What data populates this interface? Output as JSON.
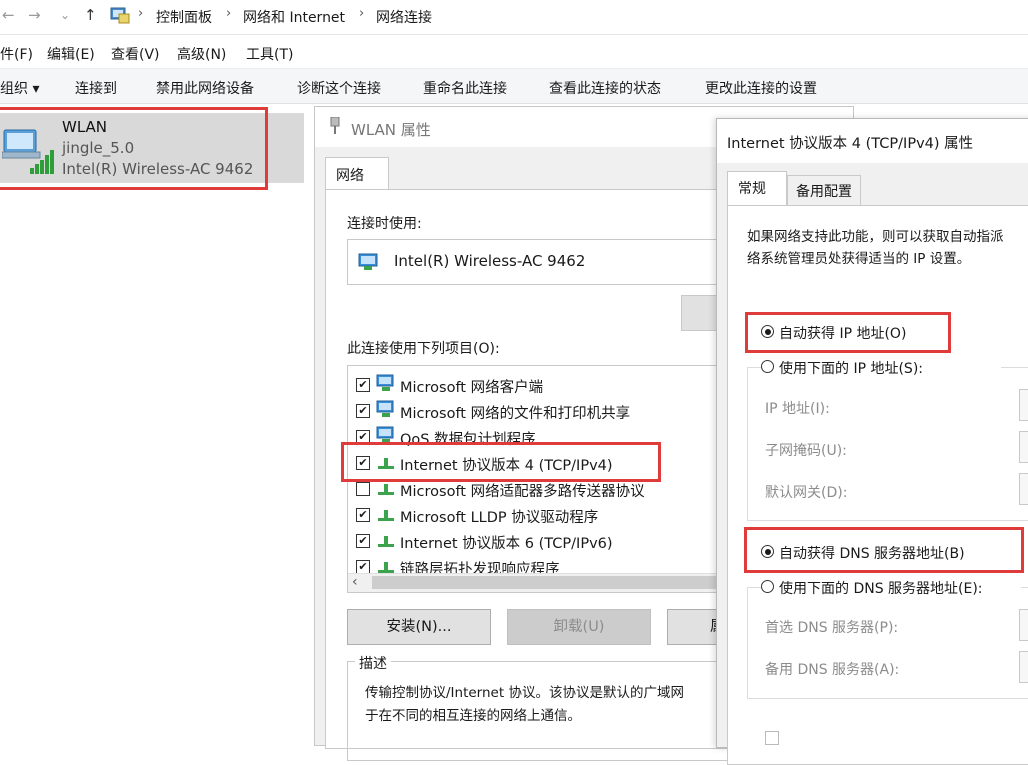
{
  "address_bar": {
    "crumbs": [
      "控制面板",
      "网络和 Internet",
      "网络连接"
    ]
  },
  "menubar": {
    "items": [
      "件(F)",
      "编辑(E)",
      "查看(V)",
      "高级(N)",
      "工具(T)"
    ]
  },
  "toolbar": {
    "items": [
      "组织 ▾",
      "连接到",
      "禁用此网络设备",
      "诊断这个连接",
      "重命名此连接",
      "查看此连接的状态",
      "更改此连接的设置"
    ]
  },
  "connection": {
    "name": "WLAN",
    "network": "jingle_5.0",
    "adapter": "Intel(R) Wireless-AC 9462"
  },
  "wlan_dialog": {
    "title": "WLAN 属性",
    "tab": "网络",
    "connect_using_label": "连接时使用:",
    "adapter": "Intel(R) Wireless-AC 9462",
    "items_label": "此连接使用下列项目(O):",
    "items": [
      {
        "label": "Microsoft 网络客户端",
        "checked": true
      },
      {
        "label": "Microsoft 网络的文件和打印机共享",
        "checked": true
      },
      {
        "label": "QoS 数据包计划程序",
        "checked": true
      },
      {
        "label": "Internet 协议版本 4 (TCP/IPv4)",
        "checked": true
      },
      {
        "label": "Microsoft 网络适配器多路传送器协议",
        "checked": false
      },
      {
        "label": "Microsoft LLDP 协议驱动程序",
        "checked": true
      },
      {
        "label": "Internet 协议版本 6 (TCP/IPv6)",
        "checked": true
      },
      {
        "label": "链路层拓扑发现响应程序",
        "checked": true
      }
    ],
    "install_button": "安装(N)...",
    "uninstall_button": "卸载(U)",
    "properties_button_partial": "属",
    "description_legend": "描述",
    "description_line1": "传输控制协议/Internet 协议。该协议是默认的广域网",
    "description_line2": "于在不同的相互连接的网络上通信。"
  },
  "ipv4_dialog": {
    "title": "Internet 协议版本 4 (TCP/IPv4) 属性",
    "tab_general": "常规",
    "tab_alternate": "备用配置",
    "info_line1": "如果网络支持此功能，则可以获取自动指派",
    "info_line2": "络系统管理员处获得适当的 IP 设置。",
    "radio_auto_ip": "自动获得 IP 地址(O)",
    "radio_manual_ip": "使用下面的 IP 地址(S):",
    "field_ip": "IP 地址(I):",
    "field_subnet": "子网掩码(U):",
    "field_gateway": "默认网关(D):",
    "radio_auto_dns": "自动获得 DNS 服务器地址(B)",
    "radio_manual_dns": "使用下面的 DNS 服务器地址(E):",
    "field_dns_pref": "首选 DNS 服务器(P):",
    "field_dns_alt": "备用 DNS 服务器(A):",
    "selected_ip_mode": "auto",
    "selected_dns_mode": "auto"
  },
  "colors": {
    "highlight_red": "#e03b3b",
    "selection_grey": "#d9d9d9",
    "dialog_bg": "#f0f0f0"
  },
  "icons": [
    "back-arrow-icon",
    "forward-arrow-icon",
    "recent-chevron-icon",
    "up-arrow-icon",
    "control-panel-icon",
    "wifi-adapter-icon",
    "network-component-icon"
  ]
}
